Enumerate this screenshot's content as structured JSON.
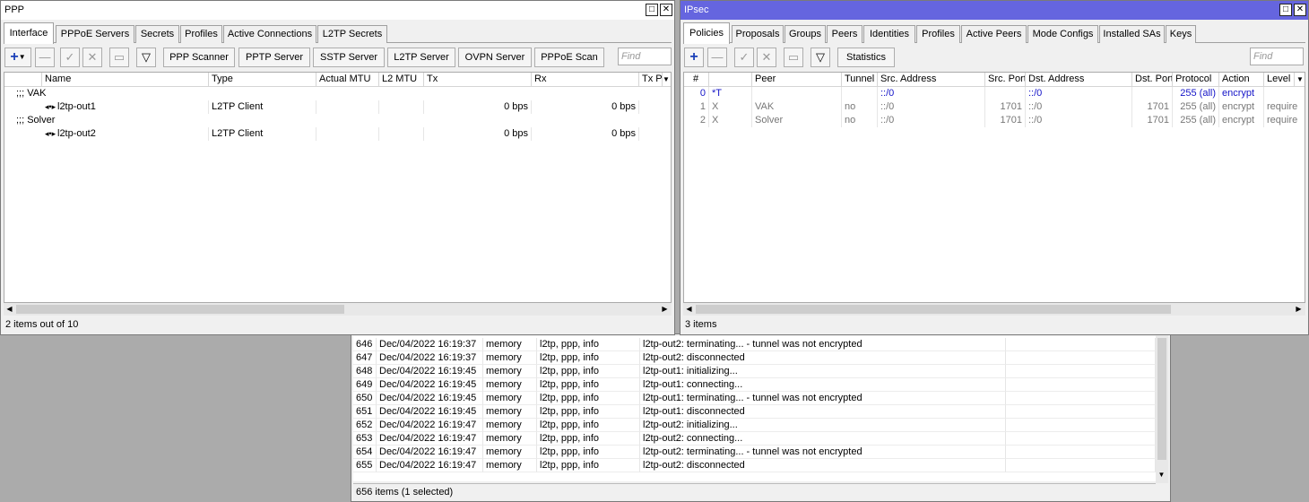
{
  "ppp": {
    "title": "PPP",
    "tabs": [
      "Interface",
      "PPPoE Servers",
      "Secrets",
      "Profiles",
      "Active Connections",
      "L2TP Secrets"
    ],
    "toolbar_buttons": [
      "PPP Scanner",
      "PPTP Server",
      "SSTP Server",
      "L2TP Server",
      "OVPN Server",
      "PPPoE Scan"
    ],
    "find_placeholder": "Find",
    "columns": [
      "Name",
      "Type",
      "Actual MTU",
      "L2 MTU",
      "Tx",
      "Rx",
      "Tx P"
    ],
    "groups": [
      {
        "label": ";;; VAK",
        "row": {
          "name": "l2tp-out1",
          "type": "L2TP Client",
          "tx": "0 bps",
          "rx": "0 bps"
        }
      },
      {
        "label": ";;; Solver",
        "row": {
          "name": "l2tp-out2",
          "type": "L2TP Client",
          "tx": "0 bps",
          "rx": "0 bps"
        }
      }
    ],
    "status": "2 items out of 10"
  },
  "ipsec": {
    "title": "IPsec",
    "tabs": [
      "Policies",
      "Proposals",
      "Groups",
      "Peers",
      "Identities",
      "Profiles",
      "Active Peers",
      "Mode Configs",
      "Installed SAs",
      "Keys"
    ],
    "stats_button": "Statistics",
    "find_placeholder": "Find",
    "columns": [
      "#",
      "Peer",
      "Tunnel",
      "Src. Address",
      "Src. Port",
      "Dst. Address",
      "Dst. Port",
      "Protocol",
      "Action",
      "Level"
    ],
    "rows": [
      {
        "num": "0",
        "flag": "*T",
        "peer": "",
        "tunnel": "",
        "src": "::/0",
        "sport": "",
        "dst": "::/0",
        "dport": "",
        "proto": "255 (all)",
        "action": "encrypt",
        "level": ""
      },
      {
        "num": "1",
        "flag": "X",
        "peer": "VAK",
        "tunnel": "no",
        "src": "::/0",
        "sport": "1701",
        "dst": "::/0",
        "dport": "1701",
        "proto": "255 (all)",
        "action": "encrypt",
        "level": "require"
      },
      {
        "num": "2",
        "flag": "X",
        "peer": "Solver",
        "tunnel": "no",
        "src": "::/0",
        "sport": "1701",
        "dst": "::/0",
        "dport": "1701",
        "proto": "255 (all)",
        "action": "encrypt",
        "level": "require"
      }
    ],
    "status": "3 items"
  },
  "log": {
    "rows": [
      {
        "id": "646",
        "time": "Dec/04/2022 16:19:37",
        "buffer": "memory",
        "topics": "l2tp, ppp, info",
        "message": "l2tp-out2: terminating... - tunnel was not encrypted"
      },
      {
        "id": "647",
        "time": "Dec/04/2022 16:19:37",
        "buffer": "memory",
        "topics": "l2tp, ppp, info",
        "message": "l2tp-out2: disconnected"
      },
      {
        "id": "648",
        "time": "Dec/04/2022 16:19:45",
        "buffer": "memory",
        "topics": "l2tp, ppp, info",
        "message": "l2tp-out1: initializing..."
      },
      {
        "id": "649",
        "time": "Dec/04/2022 16:19:45",
        "buffer": "memory",
        "topics": "l2tp, ppp, info",
        "message": "l2tp-out1: connecting..."
      },
      {
        "id": "650",
        "time": "Dec/04/2022 16:19:45",
        "buffer": "memory",
        "topics": "l2tp, ppp, info",
        "message": "l2tp-out1: terminating... - tunnel was not encrypted"
      },
      {
        "id": "651",
        "time": "Dec/04/2022 16:19:45",
        "buffer": "memory",
        "topics": "l2tp, ppp, info",
        "message": "l2tp-out1: disconnected"
      },
      {
        "id": "652",
        "time": "Dec/04/2022 16:19:47",
        "buffer": "memory",
        "topics": "l2tp, ppp, info",
        "message": "l2tp-out2: initializing..."
      },
      {
        "id": "653",
        "time": "Dec/04/2022 16:19:47",
        "buffer": "memory",
        "topics": "l2tp, ppp, info",
        "message": "l2tp-out2: connecting..."
      },
      {
        "id": "654",
        "time": "Dec/04/2022 16:19:47",
        "buffer": "memory",
        "topics": "l2tp, ppp, info",
        "message": "l2tp-out2: terminating... - tunnel was not encrypted"
      },
      {
        "id": "655",
        "time": "Dec/04/2022 16:19:47",
        "buffer": "memory",
        "topics": "l2tp, ppp, info",
        "message": "l2tp-out2: disconnected"
      }
    ],
    "status": "656 items (1 selected)"
  },
  "colors": {
    "ppp_title_bg": "#ffffff",
    "ipsec_title_bg": "#6565df",
    "accent_plus": "#1a3fb8",
    "disabled_text": "#777777",
    "active_text": "#1515c8"
  },
  "icons": [
    "plus-icon",
    "minus-icon",
    "check-icon",
    "cross-icon",
    "note-icon",
    "filter-icon",
    "interface-icon",
    "dropdown-arrow-icon",
    "maximize-icon",
    "close-icon"
  ]
}
